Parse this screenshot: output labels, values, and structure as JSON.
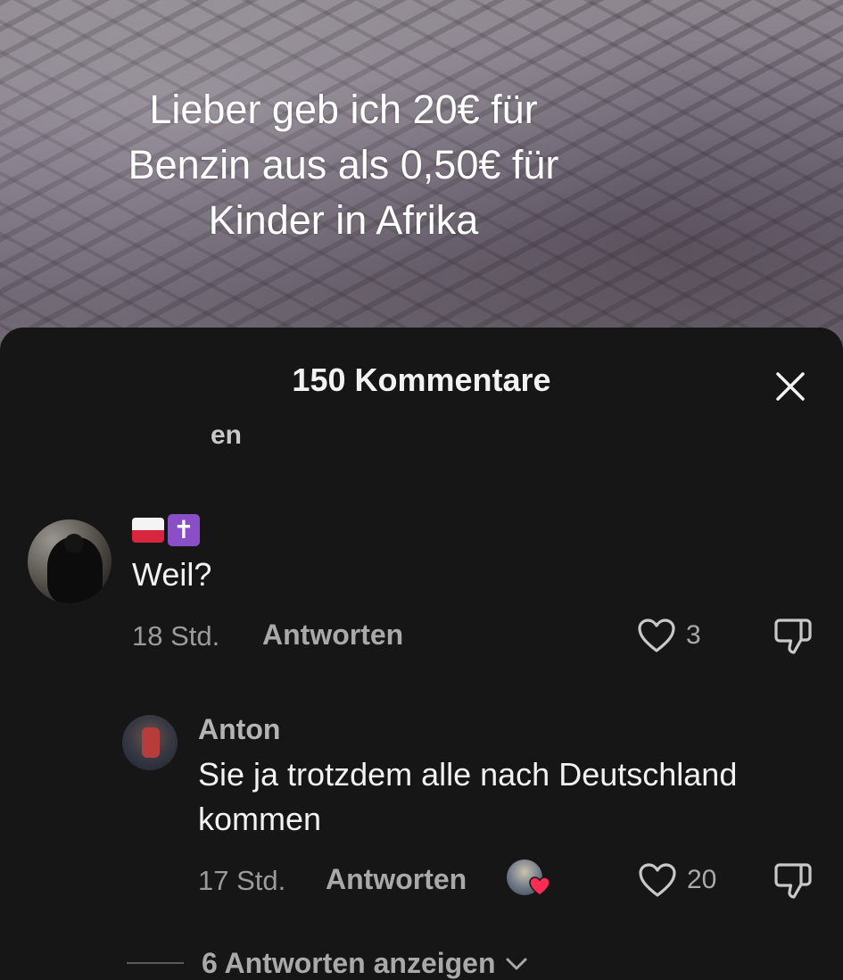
{
  "video": {
    "overlay_lines": [
      "Lieber geb ich 20€ für",
      "Benzin aus als 0,50€ für",
      "Kinder in Afrika"
    ]
  },
  "comments_sheet": {
    "title": "150 Kommentare",
    "close_icon": "close-icon",
    "partial_text": "en"
  },
  "comment": {
    "username_emoji": [
      "poland-flag",
      "latin-cross"
    ],
    "cross_glyph": "✝",
    "text": "Weil?",
    "time": "18 Std.",
    "reply_label": "Antworten",
    "likes": "3"
  },
  "reply": {
    "username": "Anton",
    "text_line1": "Sie ja trotzdem alle nach Deutschland",
    "text_line2": "kommen",
    "time": "17 Std.",
    "reply_label": "Antworten",
    "likes": "20",
    "creator_liked": true
  },
  "view_replies": {
    "label": "6 Antworten anzeigen"
  },
  "colors": {
    "sheet_bg": "#161616",
    "text_primary": "#f2f2f2",
    "text_secondary": "#a9a9a9",
    "heart_red": "#fe2c55",
    "cross_purple": "#8a4fc7"
  }
}
